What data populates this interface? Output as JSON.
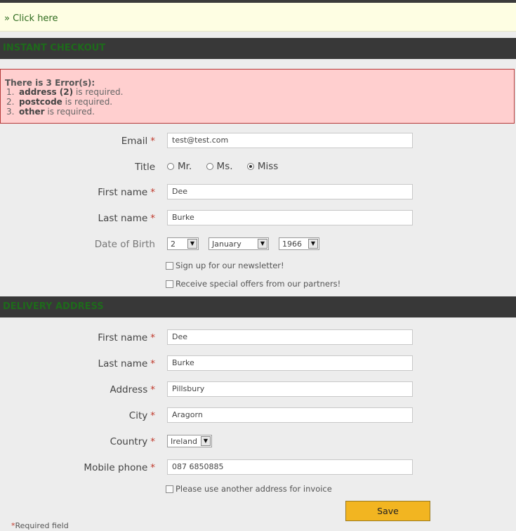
{
  "notice": {
    "link_text": "» Click here"
  },
  "instant_checkout": {
    "title": "Instant Checkout",
    "errors": {
      "heading": "There is 3 Error(s):",
      "items": [
        {
          "num": "1.",
          "field": "address (2)",
          "suffix": " is required."
        },
        {
          "num": "2.",
          "field": "postcode",
          "suffix": " is required."
        },
        {
          "num": "3.",
          "field": "other",
          "suffix": " is required."
        }
      ]
    },
    "email": {
      "label": "Email",
      "value": "test@test.com"
    },
    "title_field": {
      "label": "Title",
      "options": [
        "Mr.",
        "Ms.",
        "Miss"
      ],
      "selected": "Miss"
    },
    "first_name": {
      "label": "First name",
      "value": "Dee"
    },
    "last_name": {
      "label": "Last name",
      "value": "Burke"
    },
    "dob": {
      "label": "Date of Birth",
      "day": "2",
      "month": "January",
      "year": "1966"
    },
    "newsletter": {
      "label": "Sign up for our newsletter!"
    },
    "partners": {
      "label": "Receive special offers from our partners!"
    }
  },
  "delivery": {
    "title": "Delivery Address",
    "first_name": {
      "label": "First name",
      "value": "Dee"
    },
    "last_name": {
      "label": "Last name",
      "value": "Burke"
    },
    "address": {
      "label": "Address",
      "value": "Pillsbury"
    },
    "city": {
      "label": "City",
      "value": "Aragorn"
    },
    "country": {
      "label": "Country",
      "value": "Ireland"
    },
    "mobile": {
      "label": "Mobile phone",
      "value": "087 6850885"
    },
    "invoice": {
      "label": "Please use another address for invoice"
    }
  },
  "actions": {
    "save_label": "Save"
  },
  "footer": {
    "required_star": "*",
    "required_label": "Required field"
  },
  "required_marker": "*",
  "colors": {
    "section_bar": "#383838",
    "section_title": "#1e6a1b",
    "error_bg": "#ffcfcf",
    "save_bg": "#f2b521"
  }
}
